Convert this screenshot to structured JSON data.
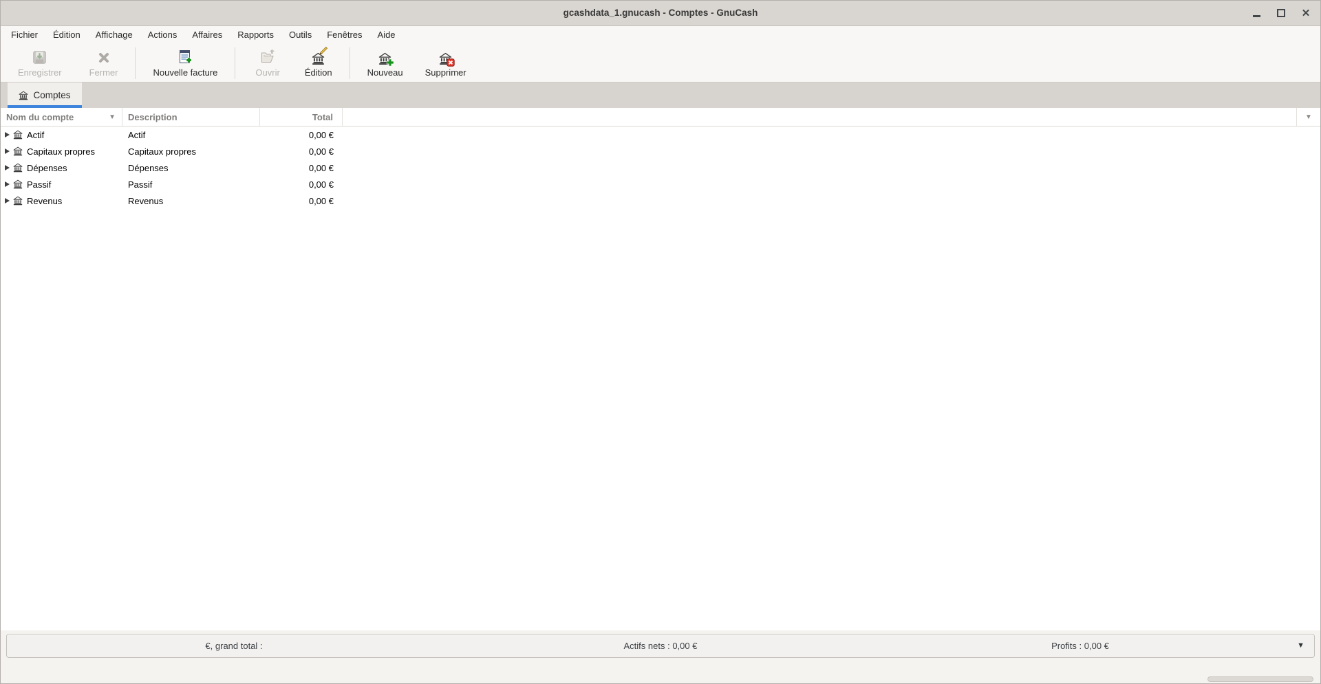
{
  "window": {
    "title": "gcashdata_1.gnucash - Comptes - GnuCash",
    "controls": [
      "minimize",
      "maximize",
      "close"
    ]
  },
  "menubar": {
    "items": [
      "Fichier",
      "Édition",
      "Affichage",
      "Actions",
      "Affaires",
      "Rapports",
      "Outils",
      "Fenêtres",
      "Aide"
    ]
  },
  "toolbar": {
    "buttons": [
      {
        "label": "Enregistrer",
        "icon": "save-icon",
        "enabled": false
      },
      {
        "label": "Fermer",
        "icon": "close-x-icon",
        "enabled": false
      },
      {
        "label": "Nouvelle facture",
        "icon": "new-invoice-icon",
        "enabled": true
      },
      {
        "label": "Ouvrir",
        "icon": "open-folder-icon",
        "enabled": false
      },
      {
        "label": "Édition",
        "icon": "edit-account-icon",
        "enabled": true
      },
      {
        "label": "Nouveau",
        "icon": "new-account-icon",
        "enabled": true
      },
      {
        "label": "Supprimer",
        "icon": "delete-account-icon",
        "enabled": true
      }
    ]
  },
  "tabs": [
    {
      "label": "Comptes",
      "icon": "bank-icon",
      "active": true
    }
  ],
  "accounts_table": {
    "columns": [
      {
        "label": "Nom du compte",
        "sort_icon": "sort-desc-arrow"
      },
      {
        "label": "Description"
      },
      {
        "label": "Total"
      }
    ],
    "rows": [
      {
        "name": "Actif",
        "description": "Actif",
        "total": "0,00 €"
      },
      {
        "name": "Capitaux propres",
        "description": "Capitaux propres",
        "total": "0,00 €"
      },
      {
        "name": "Dépenses",
        "description": "Dépenses",
        "total": "0,00 €"
      },
      {
        "name": "Passif",
        "description": "Passif",
        "total": "0,00 €"
      },
      {
        "name": "Revenus",
        "description": "Revenus",
        "total": "0,00 €"
      }
    ]
  },
  "summary_bar": {
    "grand_total_label": "€, grand total :",
    "net_assets": "Actifs nets : 0,00 €",
    "profits": "Profits : 0,00 €"
  },
  "colors": {
    "accent_blue": "#3d84dc",
    "titlebar_bg": "#d9d5d0",
    "toolbar_bg": "#f8f7f5",
    "tabstrip_bg": "#d7d3cf",
    "disabled_text": "#b6b3b0",
    "new_green": "#17911c",
    "delete_red": "#e23b2e",
    "pencil_yellow": "#f5c84f"
  }
}
